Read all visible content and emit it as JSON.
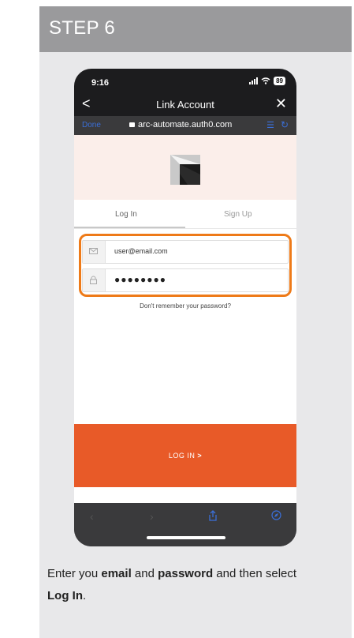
{
  "step": {
    "title": "STEP 6"
  },
  "phone": {
    "status_bar": {
      "time": "9:16",
      "battery": "89"
    },
    "nav": {
      "back": "<",
      "title": "Link Account",
      "close": "✕"
    },
    "url_bar": {
      "done": "Done",
      "url": "arc-automate.auth0.com"
    },
    "tabs": {
      "login": "Log In",
      "signup": "Sign Up"
    },
    "form": {
      "email_value": "user@email.com",
      "password_value": "●●●●●●●●",
      "forgot": "Don't remember your password?"
    },
    "login_button": {
      "label": "LOG IN",
      "chevron": ">"
    },
    "colors": {
      "accent": "#e85a28",
      "highlight": "#ee7a18",
      "link_blue": "#3a6fd8"
    }
  },
  "instruction": {
    "part1": "Enter you ",
    "email": "email",
    "part2": " and ",
    "password": "password",
    "part3": " and then select ",
    "login": "Log In",
    "part4": "."
  }
}
